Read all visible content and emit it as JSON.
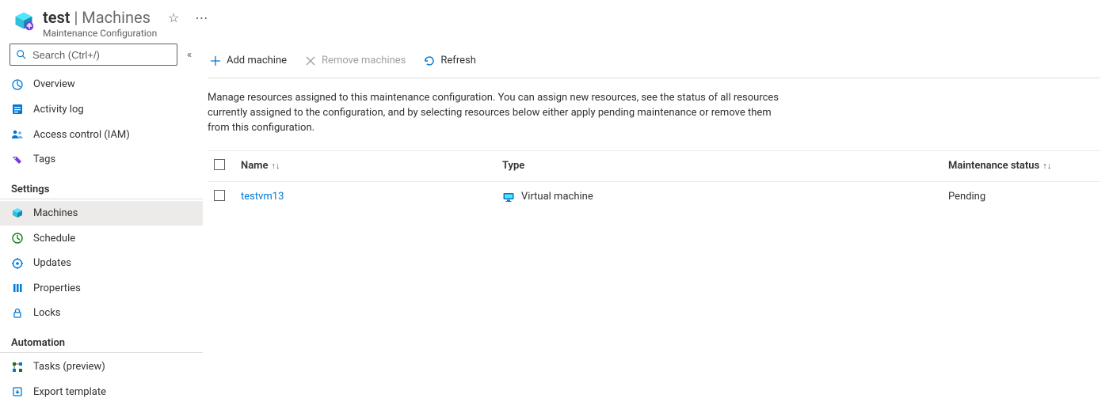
{
  "header": {
    "title_resource": "test",
    "title_separator": " | ",
    "title_blade": "Machines",
    "subtitle": "Maintenance Configuration"
  },
  "sidebar": {
    "search_placeholder": "Search (Ctrl+/)",
    "top_items": [
      {
        "label": "Overview"
      },
      {
        "label": "Activity log"
      },
      {
        "label": "Access control (IAM)"
      },
      {
        "label": "Tags"
      }
    ],
    "sections": [
      {
        "heading": "Settings",
        "items": [
          {
            "label": "Machines",
            "active": true
          },
          {
            "label": "Schedule"
          },
          {
            "label": "Updates"
          },
          {
            "label": "Properties"
          },
          {
            "label": "Locks"
          }
        ]
      },
      {
        "heading": "Automation",
        "items": [
          {
            "label": "Tasks (preview)"
          },
          {
            "label": "Export template"
          }
        ]
      }
    ]
  },
  "toolbar": {
    "add": "Add machine",
    "remove": "Remove machines",
    "refresh": "Refresh"
  },
  "description": "Manage resources assigned to this maintenance configuration. You can assign new resources, see the status of all resources currently assigned to the configuration, and by selecting resources below either apply pending maintenance or remove them from this configuration.",
  "table": {
    "columns": {
      "name": "Name",
      "type": "Type",
      "status": "Maintenance status"
    },
    "rows": [
      {
        "name": "testvm13",
        "type": "Virtual machine",
        "status": "Pending"
      }
    ]
  }
}
